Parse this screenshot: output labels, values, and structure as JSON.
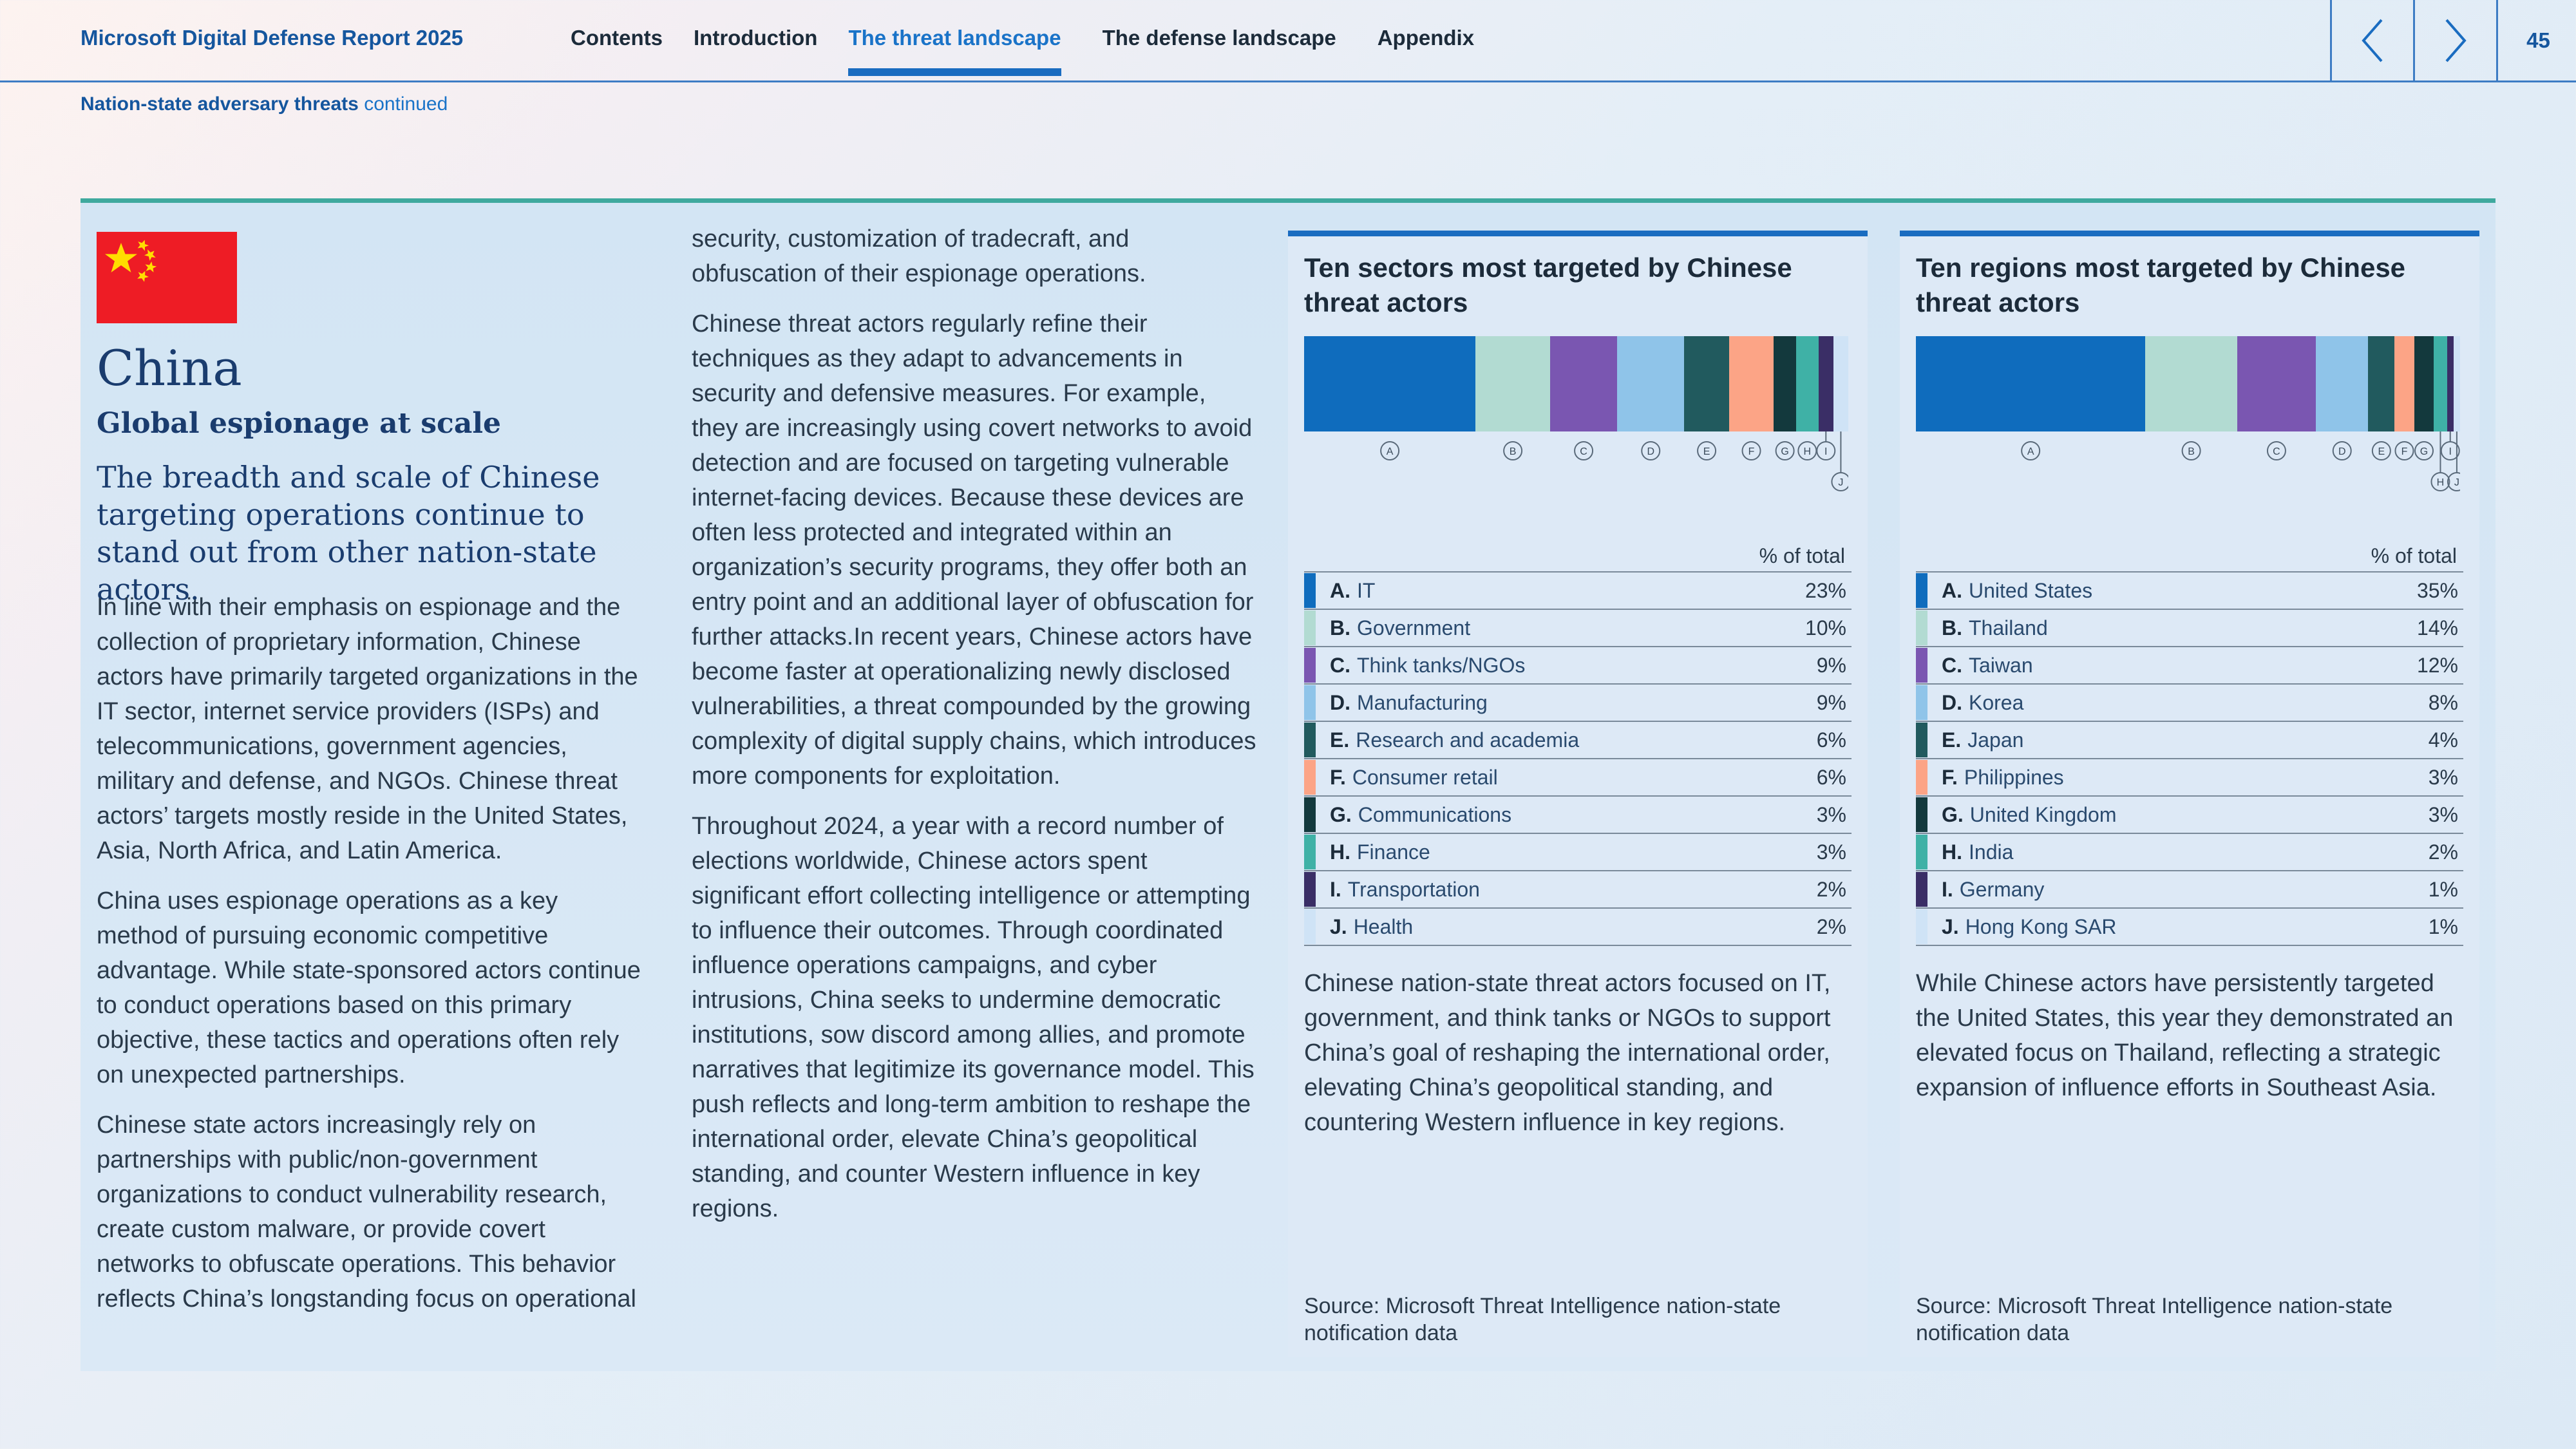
{
  "header": {
    "report_title": "Microsoft Digital Defense Report 2025",
    "nav": [
      "Contents",
      "Introduction",
      "The threat landscape",
      "The defense landscape",
      "Appendix"
    ],
    "active_nav": "The threat landscape",
    "page_number": "45",
    "prev_icon": "chevron-left-icon",
    "next_icon": "chevron-right-icon"
  },
  "section": {
    "label": "Nation-state adversary threats",
    "continued": "continued"
  },
  "country": {
    "name": "China",
    "subtitle": "Global espionage at scale",
    "lead": "The breadth and scale of Chinese targeting operations continue to stand out from other nation-state actors.",
    "flag_icon": "china-flag-icon"
  },
  "col1": {
    "p1": "In line with their emphasis on espionage and the collection of proprietary information, Chinese actors have primarily targeted organizations in the IT sector, internet service providers (ISPs) and telecommunications, government agencies, military and defense, and NGOs. Chinese threat actors’ targets mostly reside in the United States, Asia, North Africa, and Latin America.",
    "p2": "China uses espionage operations as a key method of pursuing economic competitive advantage. While state-sponsored actors continue to conduct operations based on this primary objective, these tactics and operations often rely on unexpected partnerships.",
    "p3": "Chinese state actors increasingly rely on partnerships with public/non-government organizations to conduct vulnerability research, create custom malware, or provide covert networks to obfuscate operations. This behavior reflects China’s longstanding focus on operational"
  },
  "col2": {
    "p1": "security, customization of tradecraft, and obfuscation of their espionage operations.",
    "p2": "Chinese threat actors regularly refine their techniques as they adapt to advancements in security and defensive measures. For example, they are increasingly using covert networks to avoid detection and are focused on targeting vulnerable internet-facing devices. Because these devices are often less protected and integrated within an organization’s security programs, they offer both an entry point and an additional layer of obfuscation for further attacks.In recent years, Chinese actors have become faster at operationalizing newly disclosed vulnerabilities, a threat compounded by the growing complexity of digital supply chains, which introduces more components for exploitation.",
    "p3": "Throughout 2024, a year with a record number of elections worldwide, Chinese actors spent significant effort collecting intelligence or attempting to influence their outcomes. Through coordinated influence operations campaigns, and cyber intrusions, China seeks to undermine democratic institutions, sow discord among allies, and promote narratives that legitimize its governance model. This push reflects and long-term ambition to reshape the international order, elevate China’s geopolitical standing, and counter Western influence in key regions."
  },
  "colors": [
    "#0f6cbd",
    "#b2dbd2",
    "#7a56b1",
    "#8fc4e9",
    "#215a5e",
    "#fca486",
    "#13393d",
    "#3fb1a6",
    "#3a2e66",
    "#cfe3f6"
  ],
  "chart_data": [
    {
      "type": "bar",
      "title": "Ten sectors most targeted by Chinese threat actors",
      "column_header": "% of total",
      "letters": [
        "A.",
        "B.",
        "C.",
        "D.",
        "E.",
        "F.",
        "G.",
        "H.",
        "I.",
        "J."
      ],
      "categories": [
        "IT",
        "Government",
        "Think tanks/NGOs",
        "Manufacturing",
        "Research and academia",
        "Consumer retail",
        "Communications",
        "Finance",
        "Transportation",
        "Health"
      ],
      "values": [
        23,
        10,
        9,
        9,
        6,
        6,
        3,
        3,
        2,
        2
      ],
      "value_labels": [
        "23%",
        "10%",
        "9%",
        "9%",
        "6%",
        "6%",
        "3%",
        "3%",
        "2%",
        "2%"
      ],
      "description": "Chinese nation-state threat actors focused on IT, government, and think tanks or NGOs to support China’s goal of reshaping the international order, elevating China’s geopolitical standing, and countering Western influence in key regions.",
      "source": "Source: Microsoft Threat Intelligence nation-state notification data"
    },
    {
      "type": "bar",
      "title": "Ten regions most targeted by Chinese threat actors",
      "column_header": "% of total",
      "letters": [
        "A.",
        "B.",
        "C.",
        "D.",
        "E.",
        "F.",
        "G.",
        "H.",
        "I.",
        "J."
      ],
      "categories": [
        "United States",
        "Thailand",
        "Taiwan",
        "Korea",
        "Japan",
        "Philippines",
        "United Kingdom",
        "India",
        "Germany",
        "Hong Kong SAR"
      ],
      "values": [
        35,
        14,
        12,
        8,
        4,
        3,
        3,
        2,
        1,
        1
      ],
      "value_labels": [
        "35%",
        "14%",
        "12%",
        "8%",
        "4%",
        "3%",
        "3%",
        "2%",
        "1%",
        "1%"
      ],
      "description": "While Chinese actors have persistently targeted the United States, this year they demonstrated an elevated focus on Thailand, reflecting a strategic expansion of influence efforts in Southeast Asia.",
      "source": "Source: Microsoft Threat Intelligence nation-state notification data"
    }
  ]
}
